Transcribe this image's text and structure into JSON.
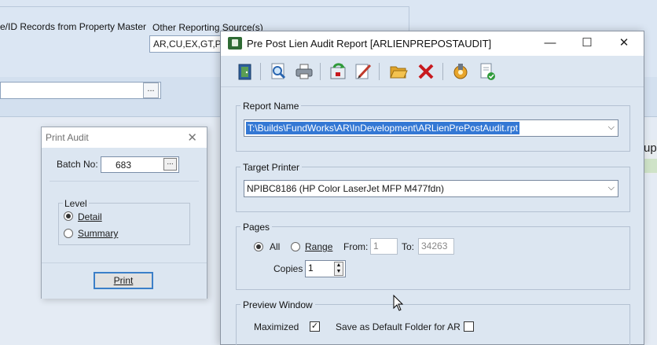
{
  "background": {
    "label_records": "e/ID Records from Property Master",
    "label_other_sources": "Other Reporting Source(s)",
    "other_sources_value": "AR,CU,EX,GT,PT,",
    "browse_label": "...",
    "right_edge_text": "upl"
  },
  "print_audit": {
    "title": "Print Audit",
    "close": "✕",
    "batch_label": "Batch No:",
    "batch_value": "683",
    "batch_btn": "...",
    "level_label": "Level",
    "options": [
      {
        "label": "Detail",
        "selected": true
      },
      {
        "label": "Summary",
        "selected": false
      }
    ],
    "print_label": "Print"
  },
  "report_dialog": {
    "title": "Pre Post Lien Audit Report [ARLIENPREPOSTAUDIT]",
    "controls": {
      "minimize": "—",
      "maximize": "☐",
      "close": "✕"
    },
    "toolbar_icons": [
      "exit-door-icon",
      "preview-icon",
      "printer-icon",
      "refresh-icon",
      "edit-icon",
      "open-folder-icon",
      "delete-icon",
      "export-icon",
      "properties-icon"
    ],
    "report_name": {
      "label": "Report Name",
      "value": "T:\\Builds\\FundWorks\\AR\\InDevelopment\\ARLienPrePostAudit.rpt"
    },
    "target_printer": {
      "label": "Target Printer",
      "value": "NPIBC8186 (HP Color LaserJet MFP M477fdn)"
    },
    "pages": {
      "label": "Pages",
      "all_label": "All",
      "range_label": "Range",
      "from_label": "From:",
      "from_value": "1",
      "to_label": "To:",
      "to_value": "34263",
      "copies_label": "Copies",
      "copies_value": "1",
      "all_selected": true
    },
    "preview_window": {
      "label": "Preview Window",
      "maximized_label": "Maximized",
      "maximized_checked": true,
      "save_default_label": "Save as Default Folder for AR",
      "save_default_checked": false
    }
  },
  "colors": {
    "accent": "#3478d4",
    "dialog_bg": "#dce6f1",
    "delete_red": "#c8191e"
  }
}
